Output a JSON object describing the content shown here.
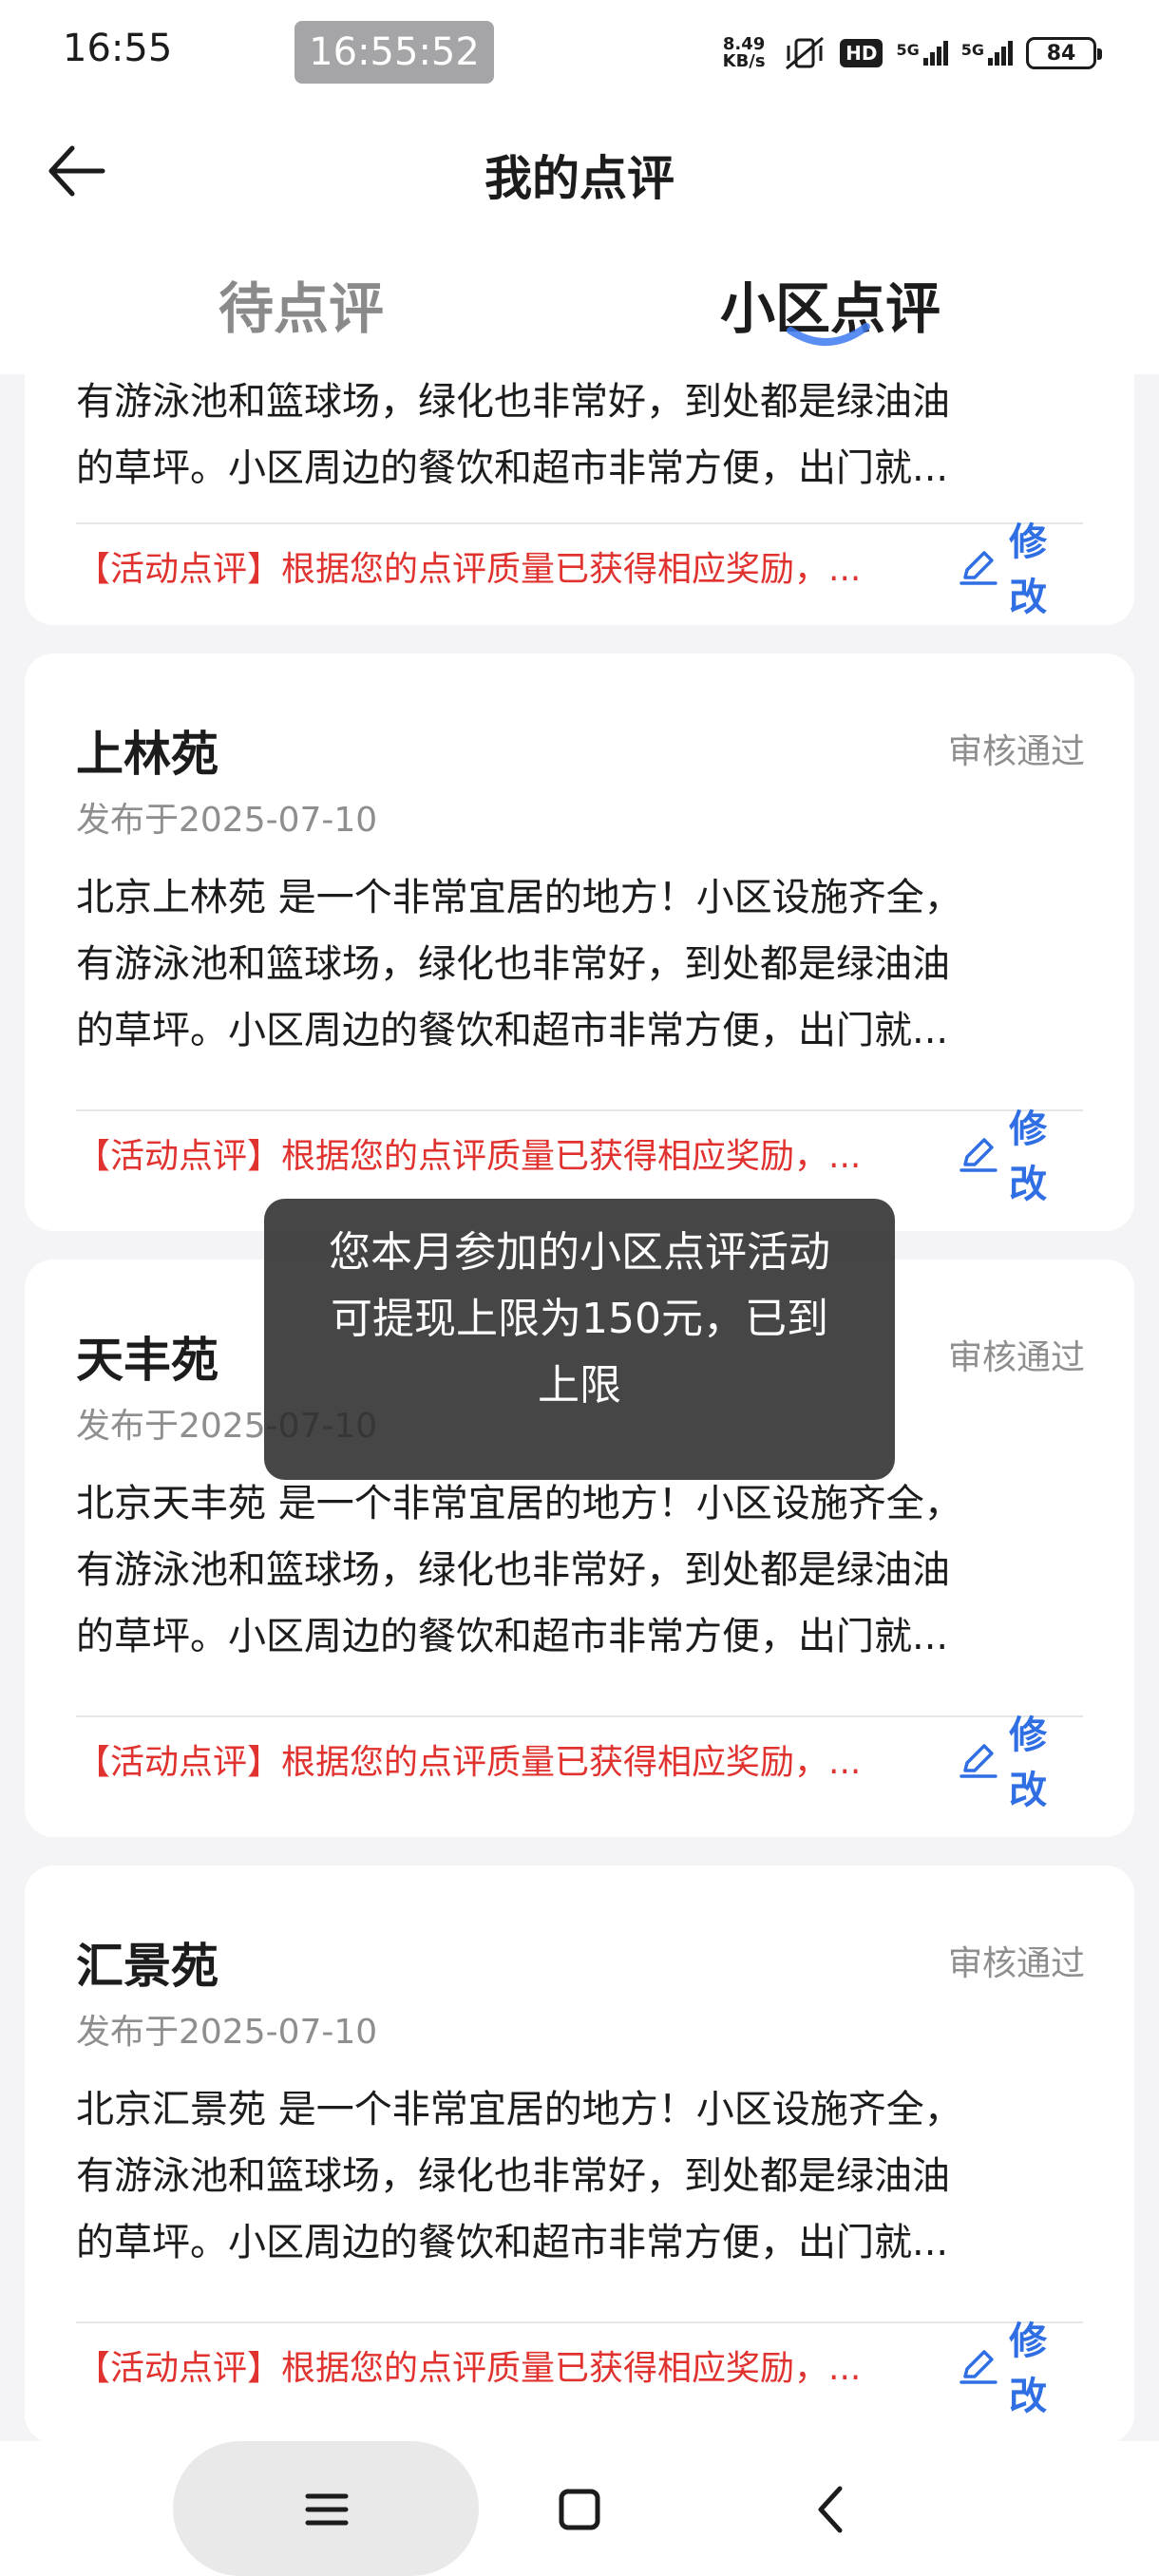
{
  "status_bar": {
    "time": "16:55",
    "clock_overlay": "16:55:52",
    "net_speed_value": "8.49",
    "net_speed_unit": "KB/s",
    "hd_badge": "HD",
    "sim1": "5G",
    "sim2": "5G",
    "battery": "84"
  },
  "header": {
    "title": "我的点评"
  },
  "tabs": [
    {
      "label": "待点评",
      "active": false
    },
    {
      "label": "小区点评",
      "active": true
    }
  ],
  "first_card_partial": {
    "body_line1": "有游泳池和篮球场，绿化也非常好，到处都是绿油油",
    "body_line2": "的草坪。小区周边的餐饮和超市非常方便，出门就...",
    "reward": "【活动点评】根据您的点评质量已获得相应奖励，...",
    "edit_label": "修改"
  },
  "cards": [
    {
      "title": "上林苑",
      "status": "审核通过",
      "date": "发布于2025-07-10",
      "body_line1": "北京上林苑 是一个非常宜居的地方！小区设施齐全，",
      "body_line2": "有游泳池和篮球场，绿化也非常好，到处都是绿油油",
      "body_line3": "的草坪。小区周边的餐饮和超市非常方便，出门就...",
      "reward": "【活动点评】根据您的点评质量已获得相应奖励，...",
      "edit_label": "修改"
    },
    {
      "title": "天丰苑",
      "status": "审核通过",
      "date": "发布于2025-07-10",
      "body_line1": "北京天丰苑 是一个非常宜居的地方！小区设施齐全，",
      "body_line2": "有游泳池和篮球场，绿化也非常好，到处都是绿油油",
      "body_line3": "的草坪。小区周边的餐饮和超市非常方便，出门就...",
      "reward": "【活动点评】根据您的点评质量已获得相应奖励，...",
      "edit_label": "修改"
    },
    {
      "title": "汇景苑",
      "status": "审核通过",
      "date": "发布于2025-07-10",
      "body_line1": "北京汇景苑 是一个非常宜居的地方！小区设施齐全，",
      "body_line2": "有游泳池和篮球场，绿化也非常好，到处都是绿油油",
      "body_line3": "的草坪。小区周边的餐饮和超市非常方便，出门就...",
      "reward": "【活动点评】根据您的点评质量已获得相应奖励，...",
      "edit_label": "修改"
    }
  ],
  "toast": {
    "line1": "您本月参加的小区点评活动",
    "line2": "可提现上限为150元，已到",
    "line3": "上限"
  },
  "colors": {
    "accent_blue": "#2f6fe3",
    "reward_red": "#e0322f",
    "muted_gray": "#8e8e8e",
    "background": "#f4f4f6"
  },
  "icons": {
    "back": "arrow-left-icon",
    "edit": "pencil-icon",
    "nav_menu": "menu-icon",
    "nav_home": "square-icon",
    "nav_back": "chevron-left-icon"
  }
}
